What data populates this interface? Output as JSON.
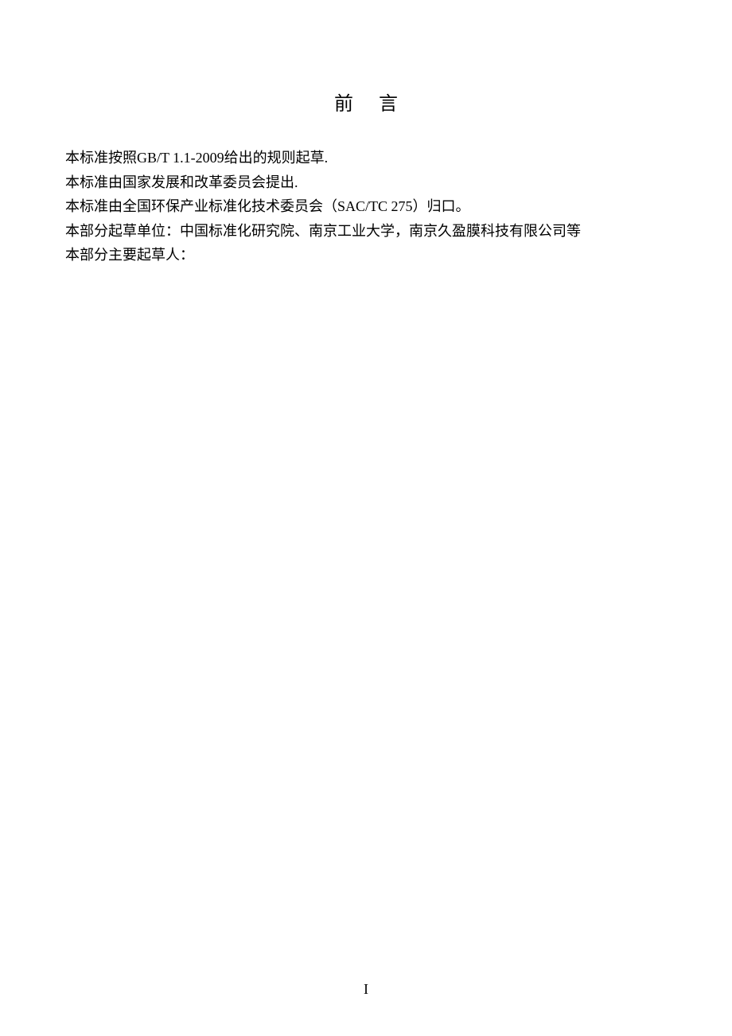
{
  "title": "前言",
  "paragraphs": {
    "p1": "本标准按照GB/T 1.1-2009给出的规则起草.",
    "p2": "本标准由国家发展和改革委员会提出.",
    "p3": "本标准由全国环保产业标准化技术委员会（SAC/TC 275）归口。",
    "p4": "本部分起草单位：中国标准化研究院、南京工业大学，南京久盈膜科技有限公司等",
    "p5": "本部分主要起草人："
  },
  "pageNumber": "I"
}
